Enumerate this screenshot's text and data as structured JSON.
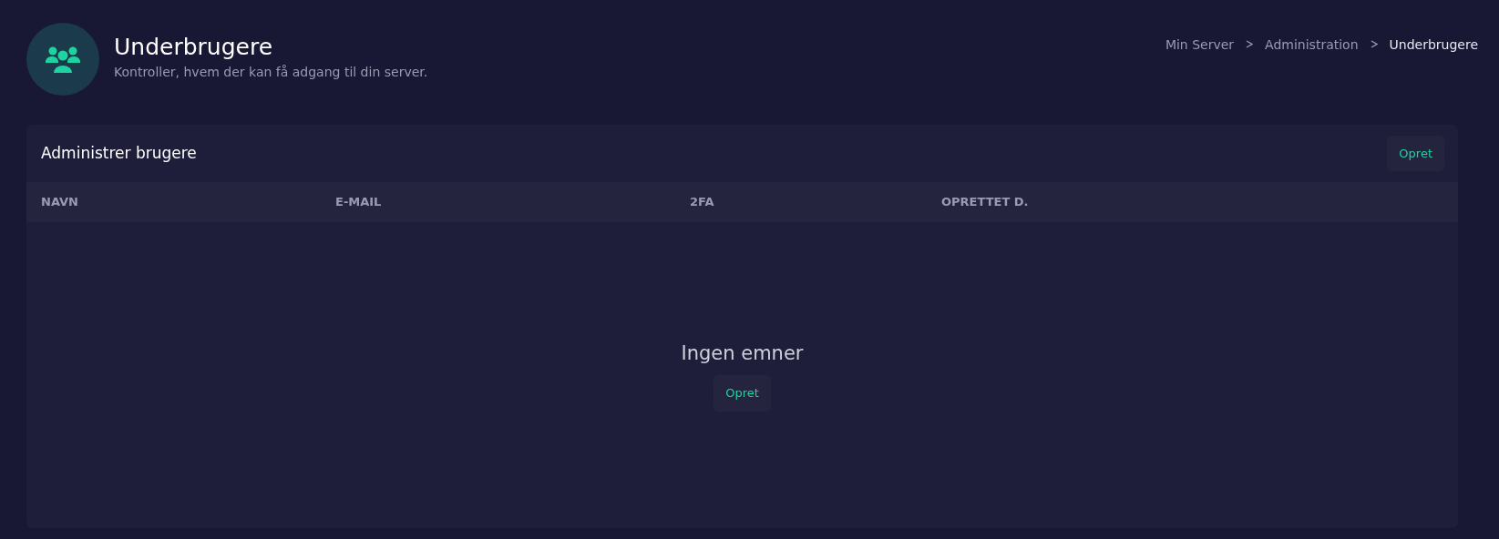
{
  "page": {
    "title": "Underbrugere",
    "subtitle": "Kontroller, hvem der kan få adgang til din server."
  },
  "breadcrumb": [
    {
      "label": "Min Server",
      "current": false
    },
    {
      "label": "Administration",
      "current": false
    },
    {
      "label": "Underbrugere",
      "current": true
    }
  ],
  "card": {
    "title": "Administrer brugere",
    "button": "Opret",
    "table": {
      "columns": [
        "NAVN",
        "E-MAIL",
        "2FA",
        "OPRETTET D."
      ]
    },
    "empty": {
      "message": "Ingen emner",
      "button": "Opret"
    }
  }
}
